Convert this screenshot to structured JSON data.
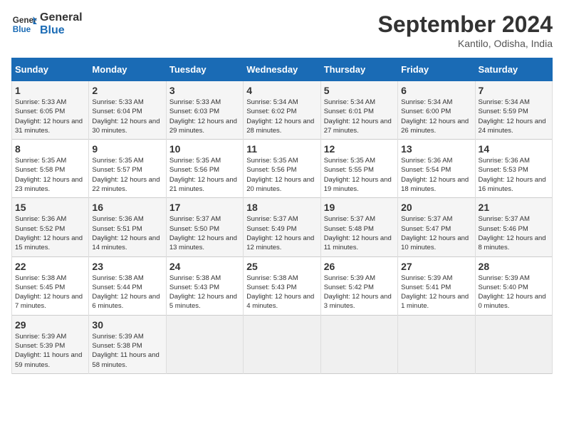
{
  "header": {
    "logo_line1": "General",
    "logo_line2": "Blue",
    "month": "September 2024",
    "location": "Kantilo, Odisha, India"
  },
  "days_of_week": [
    "Sunday",
    "Monday",
    "Tuesday",
    "Wednesday",
    "Thursday",
    "Friday",
    "Saturday"
  ],
  "weeks": [
    [
      {
        "num": "1",
        "sunrise": "5:33 AM",
        "sunset": "6:05 PM",
        "daylight": "12 hours and 31 minutes."
      },
      {
        "num": "2",
        "sunrise": "5:33 AM",
        "sunset": "6:04 PM",
        "daylight": "12 hours and 30 minutes."
      },
      {
        "num": "3",
        "sunrise": "5:33 AM",
        "sunset": "6:03 PM",
        "daylight": "12 hours and 29 minutes."
      },
      {
        "num": "4",
        "sunrise": "5:34 AM",
        "sunset": "6:02 PM",
        "daylight": "12 hours and 28 minutes."
      },
      {
        "num": "5",
        "sunrise": "5:34 AM",
        "sunset": "6:01 PM",
        "daylight": "12 hours and 27 minutes."
      },
      {
        "num": "6",
        "sunrise": "5:34 AM",
        "sunset": "6:00 PM",
        "daylight": "12 hours and 26 minutes."
      },
      {
        "num": "7",
        "sunrise": "5:34 AM",
        "sunset": "5:59 PM",
        "daylight": "12 hours and 24 minutes."
      }
    ],
    [
      {
        "num": "8",
        "sunrise": "5:35 AM",
        "sunset": "5:58 PM",
        "daylight": "12 hours and 23 minutes."
      },
      {
        "num": "9",
        "sunrise": "5:35 AM",
        "sunset": "5:57 PM",
        "daylight": "12 hours and 22 minutes."
      },
      {
        "num": "10",
        "sunrise": "5:35 AM",
        "sunset": "5:56 PM",
        "daylight": "12 hours and 21 minutes."
      },
      {
        "num": "11",
        "sunrise": "5:35 AM",
        "sunset": "5:56 PM",
        "daylight": "12 hours and 20 minutes."
      },
      {
        "num": "12",
        "sunrise": "5:35 AM",
        "sunset": "5:55 PM",
        "daylight": "12 hours and 19 minutes."
      },
      {
        "num": "13",
        "sunrise": "5:36 AM",
        "sunset": "5:54 PM",
        "daylight": "12 hours and 18 minutes."
      },
      {
        "num": "14",
        "sunrise": "5:36 AM",
        "sunset": "5:53 PM",
        "daylight": "12 hours and 16 minutes."
      }
    ],
    [
      {
        "num": "15",
        "sunrise": "5:36 AM",
        "sunset": "5:52 PM",
        "daylight": "12 hours and 15 minutes."
      },
      {
        "num": "16",
        "sunrise": "5:36 AM",
        "sunset": "5:51 PM",
        "daylight": "12 hours and 14 minutes."
      },
      {
        "num": "17",
        "sunrise": "5:37 AM",
        "sunset": "5:50 PM",
        "daylight": "12 hours and 13 minutes."
      },
      {
        "num": "18",
        "sunrise": "5:37 AM",
        "sunset": "5:49 PM",
        "daylight": "12 hours and 12 minutes."
      },
      {
        "num": "19",
        "sunrise": "5:37 AM",
        "sunset": "5:48 PM",
        "daylight": "12 hours and 11 minutes."
      },
      {
        "num": "20",
        "sunrise": "5:37 AM",
        "sunset": "5:47 PM",
        "daylight": "12 hours and 10 minutes."
      },
      {
        "num": "21",
        "sunrise": "5:37 AM",
        "sunset": "5:46 PM",
        "daylight": "12 hours and 8 minutes."
      }
    ],
    [
      {
        "num": "22",
        "sunrise": "5:38 AM",
        "sunset": "5:45 PM",
        "daylight": "12 hours and 7 minutes."
      },
      {
        "num": "23",
        "sunrise": "5:38 AM",
        "sunset": "5:44 PM",
        "daylight": "12 hours and 6 minutes."
      },
      {
        "num": "24",
        "sunrise": "5:38 AM",
        "sunset": "5:43 PM",
        "daylight": "12 hours and 5 minutes."
      },
      {
        "num": "25",
        "sunrise": "5:38 AM",
        "sunset": "5:43 PM",
        "daylight": "12 hours and 4 minutes."
      },
      {
        "num": "26",
        "sunrise": "5:39 AM",
        "sunset": "5:42 PM",
        "daylight": "12 hours and 3 minutes."
      },
      {
        "num": "27",
        "sunrise": "5:39 AM",
        "sunset": "5:41 PM",
        "daylight": "12 hours and 1 minute."
      },
      {
        "num": "28",
        "sunrise": "5:39 AM",
        "sunset": "5:40 PM",
        "daylight": "12 hours and 0 minutes."
      }
    ],
    [
      {
        "num": "29",
        "sunrise": "5:39 AM",
        "sunset": "5:39 PM",
        "daylight": "11 hours and 59 minutes."
      },
      {
        "num": "30",
        "sunrise": "5:39 AM",
        "sunset": "5:38 PM",
        "daylight": "11 hours and 58 minutes."
      },
      null,
      null,
      null,
      null,
      null
    ]
  ]
}
